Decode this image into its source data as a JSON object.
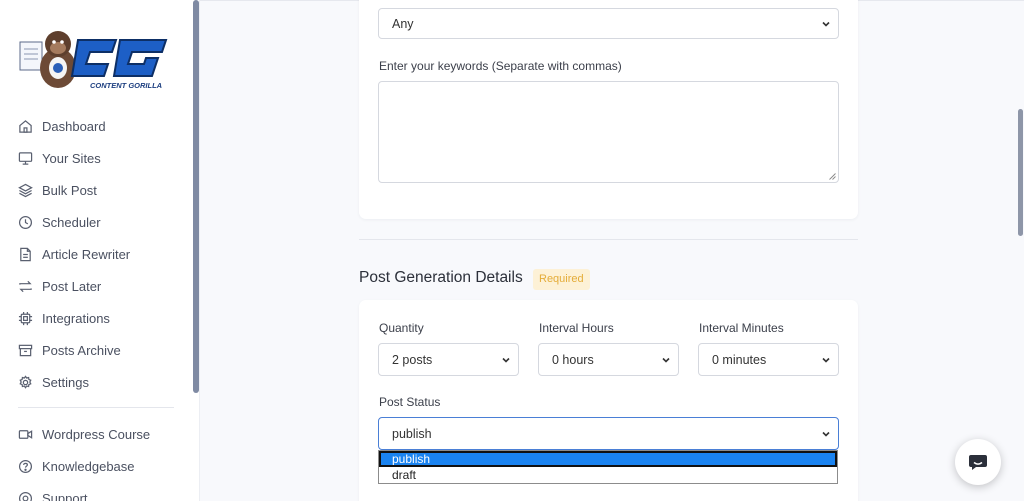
{
  "brand": {
    "logo_text": "CG",
    "logo_subtext": "CONTENT GORILLA"
  },
  "sidebar": {
    "items": [
      {
        "label": "Dashboard",
        "icon": "home-icon"
      },
      {
        "label": "Your Sites",
        "icon": "monitor-icon"
      },
      {
        "label": "Bulk Post",
        "icon": "layers-icon"
      },
      {
        "label": "Scheduler",
        "icon": "clock-icon"
      },
      {
        "label": "Article Rewriter",
        "icon": "file-text-icon"
      },
      {
        "label": "Post Later",
        "icon": "repeat-icon"
      },
      {
        "label": "Integrations",
        "icon": "cpu-icon"
      },
      {
        "label": "Posts Archive",
        "icon": "archive-icon"
      },
      {
        "label": "Settings",
        "icon": "gear-icon"
      }
    ],
    "secondary": [
      {
        "label": "Wordpress Course",
        "icon": "video-icon"
      },
      {
        "label": "Knowledgebase",
        "icon": "help-circle-icon"
      },
      {
        "label": "Support",
        "icon": "support-icon"
      }
    ]
  },
  "filters": {
    "top_select_value": "Any",
    "keywords_label": "Enter your keywords (Separate with commas)",
    "keywords_value": ""
  },
  "post_generation": {
    "title": "Post Generation Details",
    "badge": "Required",
    "quantity_label": "Quantity",
    "quantity_value": "2 posts",
    "interval_hours_label": "Interval Hours",
    "interval_hours_value": "0 hours",
    "interval_minutes_label": "Interval Minutes",
    "interval_minutes_value": "0 minutes",
    "status_label": "Post Status",
    "status_value": "publish",
    "status_options": [
      "publish",
      "draft"
    ]
  },
  "colors": {
    "badge_bg": "#fdf1d6",
    "badge_text": "#e4ac39",
    "selected_option": "#1a83f0",
    "focus_border": "#4a7fd6"
  },
  "chat": {
    "icon": "chat-icon"
  }
}
